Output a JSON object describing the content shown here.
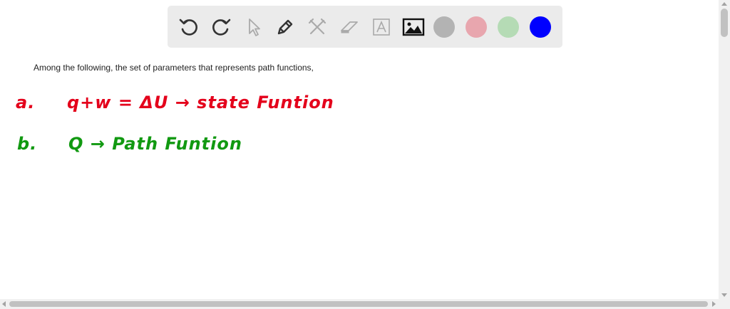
{
  "toolbar": {
    "tools": [
      {
        "name": "undo-icon",
        "enabled": true
      },
      {
        "name": "redo-icon",
        "enabled": true
      },
      {
        "name": "select-pointer-icon",
        "enabled": false
      },
      {
        "name": "pen-icon",
        "enabled": true
      },
      {
        "name": "tools-icon",
        "enabled": false
      },
      {
        "name": "eraser-icon",
        "enabled": false
      },
      {
        "name": "text-icon",
        "enabled": false
      },
      {
        "name": "image-icon",
        "enabled": true
      }
    ],
    "colors": [
      "#b3b3b3",
      "#e8a6ae",
      "#b5dbb5",
      "#0000ff"
    ]
  },
  "content": {
    "prompt": "Among the following, the set of parameters that represents path functions,",
    "line_a": {
      "label": "a.",
      "text": "q+w = ΔU → state Funtion",
      "color": "#e4001b"
    },
    "line_b": {
      "label": "b.",
      "text": "Q → Path Funtion",
      "color": "#119911"
    }
  }
}
